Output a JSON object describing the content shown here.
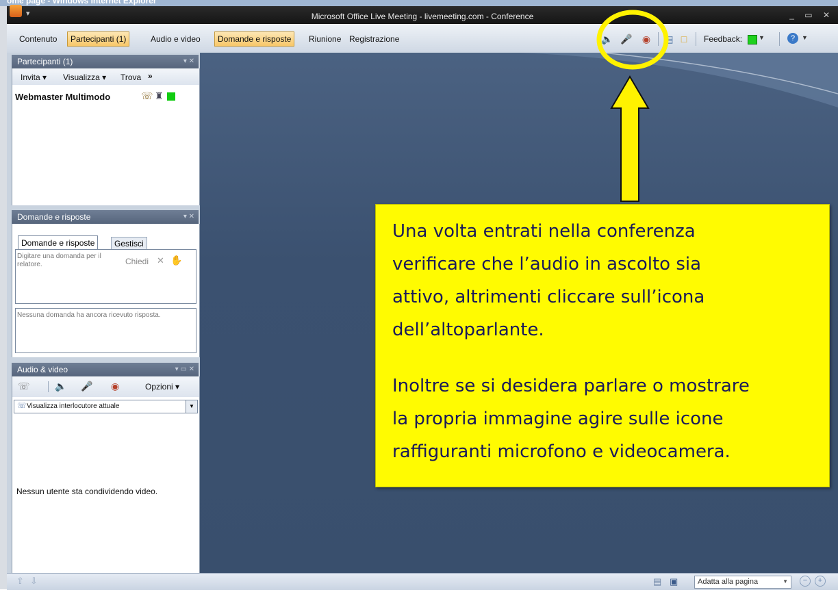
{
  "ie_title": "ome page - Windows Internet Explorer",
  "app": {
    "title": "Microsoft Office Live Meeting - livemeeting.com - Conference",
    "quick_access": "▾",
    "window_controls": "_ ▭ ✕"
  },
  "menu": {
    "items": [
      "Contenuto",
      "Partecipanti (1)",
      "Audio e video",
      "Domande e risposte",
      "Riunione",
      "Registrazione"
    ],
    "feedback_label": "Feedback:"
  },
  "participants_panel": {
    "header": "Partecipanti (1)",
    "controls": "▾  ✕",
    "toolbar": [
      "Invita ▾",
      "Visualizza ▾",
      "Trova",
      "»"
    ],
    "participant_name": "Webmaster Multimodo"
  },
  "qa_panel": {
    "header": "Domande e risposte",
    "controls": "▾  ✕",
    "tabs": [
      "Domande e risposte",
      "Gestisci"
    ],
    "input_placeholder": "Digitare una domanda per il relatore.",
    "ask_label": "Chiedi",
    "empty_message": "Nessuna domanda ha ancora ricevuto risposta."
  },
  "av_panel": {
    "header": "Audio & video",
    "controls": "▾  ▭  ✕",
    "options_label": "Opzioni ▾",
    "dropdown_value": "Visualizza interlocutore attuale",
    "no_video_message": "Nessun utente sta condividendo video."
  },
  "callout": {
    "lines": [
      "Una volta entrati nella conferenza",
      "verificare che l’audio in ascolto sia",
      "attivo, altrimenti cliccare sull’icona",
      "dell’altoparlante.",
      "Inoltre se si desidera parlare o mostrare",
      "la propria immagine agire sulle icone",
      "raffiguranti microfono e videocamera."
    ],
    "color": "#fffb01"
  },
  "statusbar": {
    "zoom_value": "Adatta alla pagina"
  },
  "colors": {
    "highlight": "#fff200",
    "panel_header": "#5e6d84",
    "workspace": "#3f5676"
  }
}
